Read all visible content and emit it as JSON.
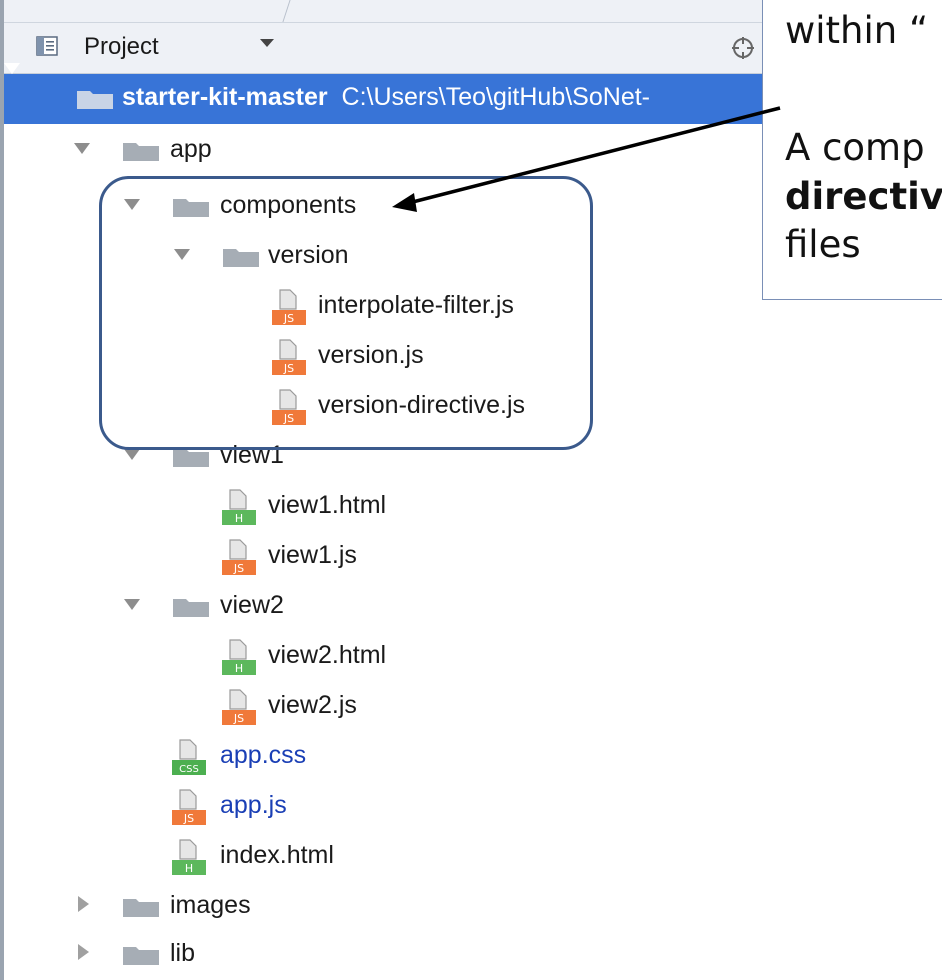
{
  "toolbar": {
    "label": "Project"
  },
  "tree": {
    "root": {
      "name": "starter-kit-master",
      "path": "C:\\Users\\Teo\\gitHub\\SoNet-"
    },
    "app": "app",
    "components": "components",
    "version_folder": "version",
    "interpolate_filter": "interpolate-filter.js",
    "version_js": "version.js",
    "version_directive": "version-directive.js",
    "view1": "view1",
    "view1_html": "view1.html",
    "view1_js": "view1.js",
    "view2": "view2",
    "view2_html": "view2.html",
    "view2_js": "view2.js",
    "app_css": "app.css",
    "app_js": "app.js",
    "index_html": "index.html",
    "images": "images",
    "lib": "lib"
  },
  "file_badges": {
    "js": "JS",
    "html": "H",
    "css": "CSS"
  },
  "annotation": {
    "line1": "within “",
    "line2": "A comp",
    "line3_bold": "directiv",
    "line4": "files"
  },
  "colors": {
    "selection": "#3874d7",
    "folder": "#a6adb5",
    "js_badge": "#f0793a",
    "html_badge": "#5cb85c",
    "css_badge": "#4caf50",
    "highlight_border": "#3b5a8c",
    "link_text": "#1a3fb5"
  }
}
